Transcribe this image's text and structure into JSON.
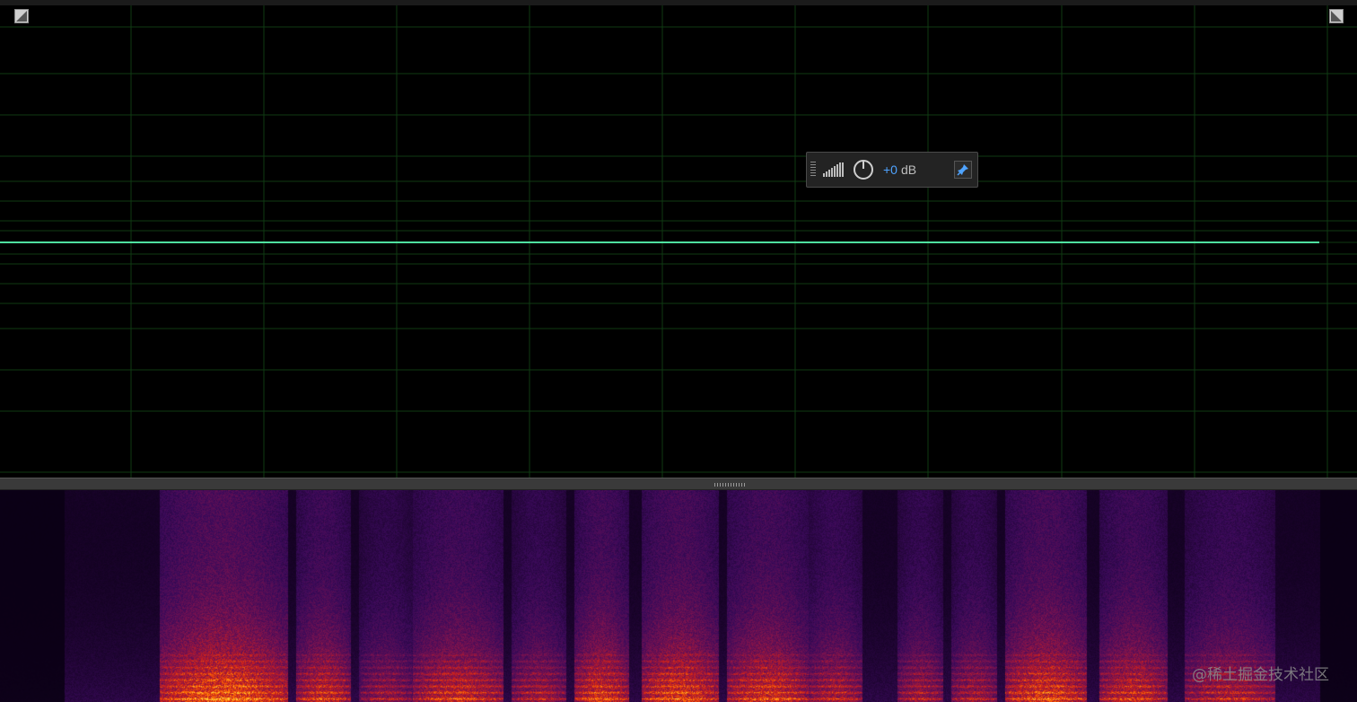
{
  "editor": {
    "waveform_panel": {
      "waveform_color": "#4fe0a0",
      "grid_color": "#0f3a12",
      "background": "#000000"
    },
    "spectral_panel": {
      "palette": [
        "#0a0014",
        "#3a0a5a",
        "#7a1250",
        "#c81e1e",
        "#ff6a00",
        "#ffd23a"
      ]
    },
    "corner_buttons": {
      "left_icon": "zoom-corner-icon",
      "right_icon": "zoom-corner-icon"
    }
  },
  "hud": {
    "level_icon": "signal-level-icon",
    "knob_icon": "volume-knob-icon",
    "gain_value": "+0",
    "gain_unit": "dB",
    "pin_icon": "pin-icon"
  },
  "watermark": "@稀土掘金技术社区"
}
